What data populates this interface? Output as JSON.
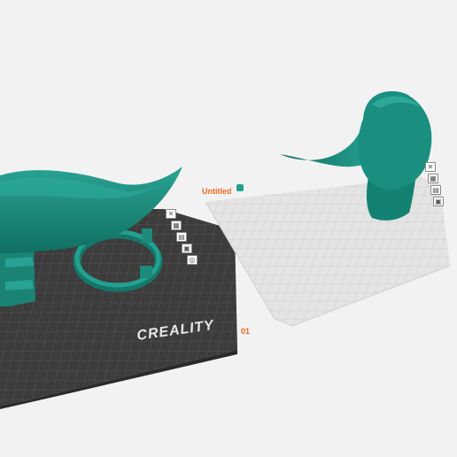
{
  "plates": [
    {
      "name": "01",
      "style": "dark",
      "brand": "CREALITY"
    },
    {
      "name": "Untitled",
      "style": "light"
    }
  ],
  "plate_tools": {
    "plate1": [
      "close-icon",
      "arrange-icon",
      "layout-icon",
      "lock-icon",
      "settings-icon"
    ],
    "plate2": [
      "close-icon",
      "arrange-icon",
      "layout-icon",
      "lock-icon",
      "settings-icon"
    ]
  },
  "colors": {
    "background": "#f2f2f2",
    "model": "#1a8a7a",
    "plate_dark": "#3a3a3a",
    "plate_light": "#e6e6e6",
    "accent": "#f26722"
  }
}
